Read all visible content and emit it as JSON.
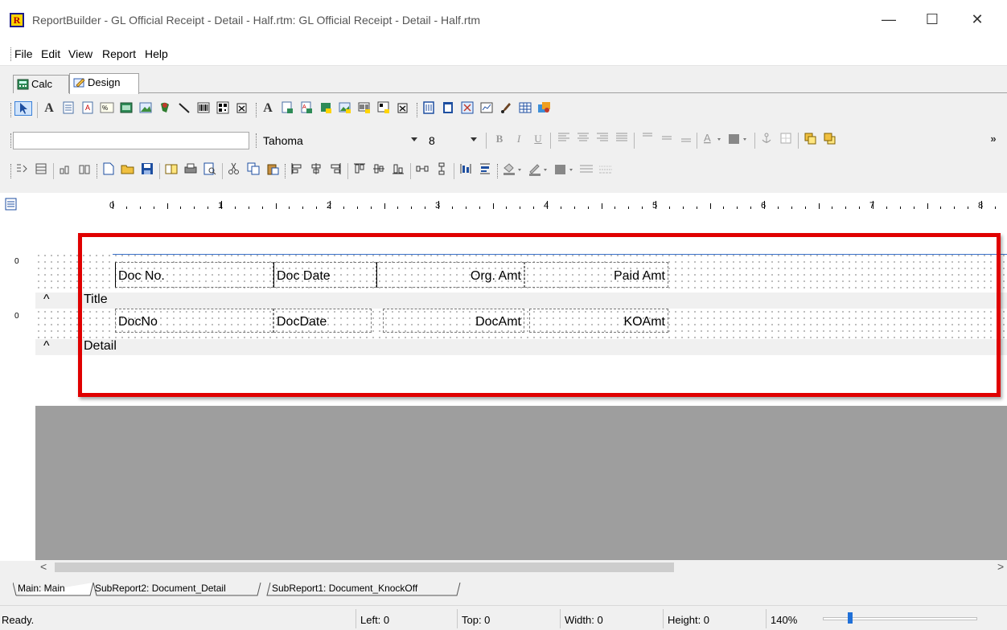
{
  "window": {
    "title": "ReportBuilder - GL Official Receipt - Detail - Half.rtm: GL Official Receipt - Detail - Half.rtm",
    "logo_letter": "R",
    "minimize": "—",
    "maximize": "☐",
    "close": "✕"
  },
  "menu": [
    "File",
    "Edit",
    "View",
    "Report",
    "Help"
  ],
  "tabs": [
    {
      "label": "Calc"
    },
    {
      "label": "Design"
    }
  ],
  "format_bar": {
    "font_name": "Tahoma",
    "font_size": "8",
    "more": "»"
  },
  "ruler": {
    "marks": [
      "0",
      "1",
      "2",
      "3",
      "4",
      "5",
      "6",
      "7",
      "8"
    ]
  },
  "bands": [
    {
      "name": "Title",
      "ruler_mark": "0",
      "fields": [
        {
          "text": "Doc No.",
          "align": "left"
        },
        {
          "text": "Doc Date",
          "align": "left"
        },
        {
          "text": "Org. Amt",
          "align": "right"
        },
        {
          "text": "Paid Amt",
          "align": "right"
        }
      ]
    },
    {
      "name": "Detail",
      "ruler_mark": "0",
      "fields": [
        {
          "text": "DocNo",
          "align": "left"
        },
        {
          "text": "DocDate",
          "align": "left"
        },
        {
          "text": "DocAmt",
          "align": "right"
        },
        {
          "text": "KOAmt",
          "align": "right"
        }
      ]
    }
  ],
  "band_toggle": "^",
  "scroll": {
    "left": "<",
    "right": ">"
  },
  "sheet_tabs": [
    "Main: Main",
    "SubReport2: Document_Detail",
    "SubReport1: Document_KnockOff"
  ],
  "status": {
    "text": "Ready.",
    "left": "Left: 0",
    "top": "Top: 0",
    "width": "Width: 0",
    "height": "Height: 0",
    "zoom": "140%"
  },
  "colors": {
    "highlight": "#e00000",
    "accent_blue": "#2070d8",
    "workspace_gray": "#9e9e9e"
  }
}
